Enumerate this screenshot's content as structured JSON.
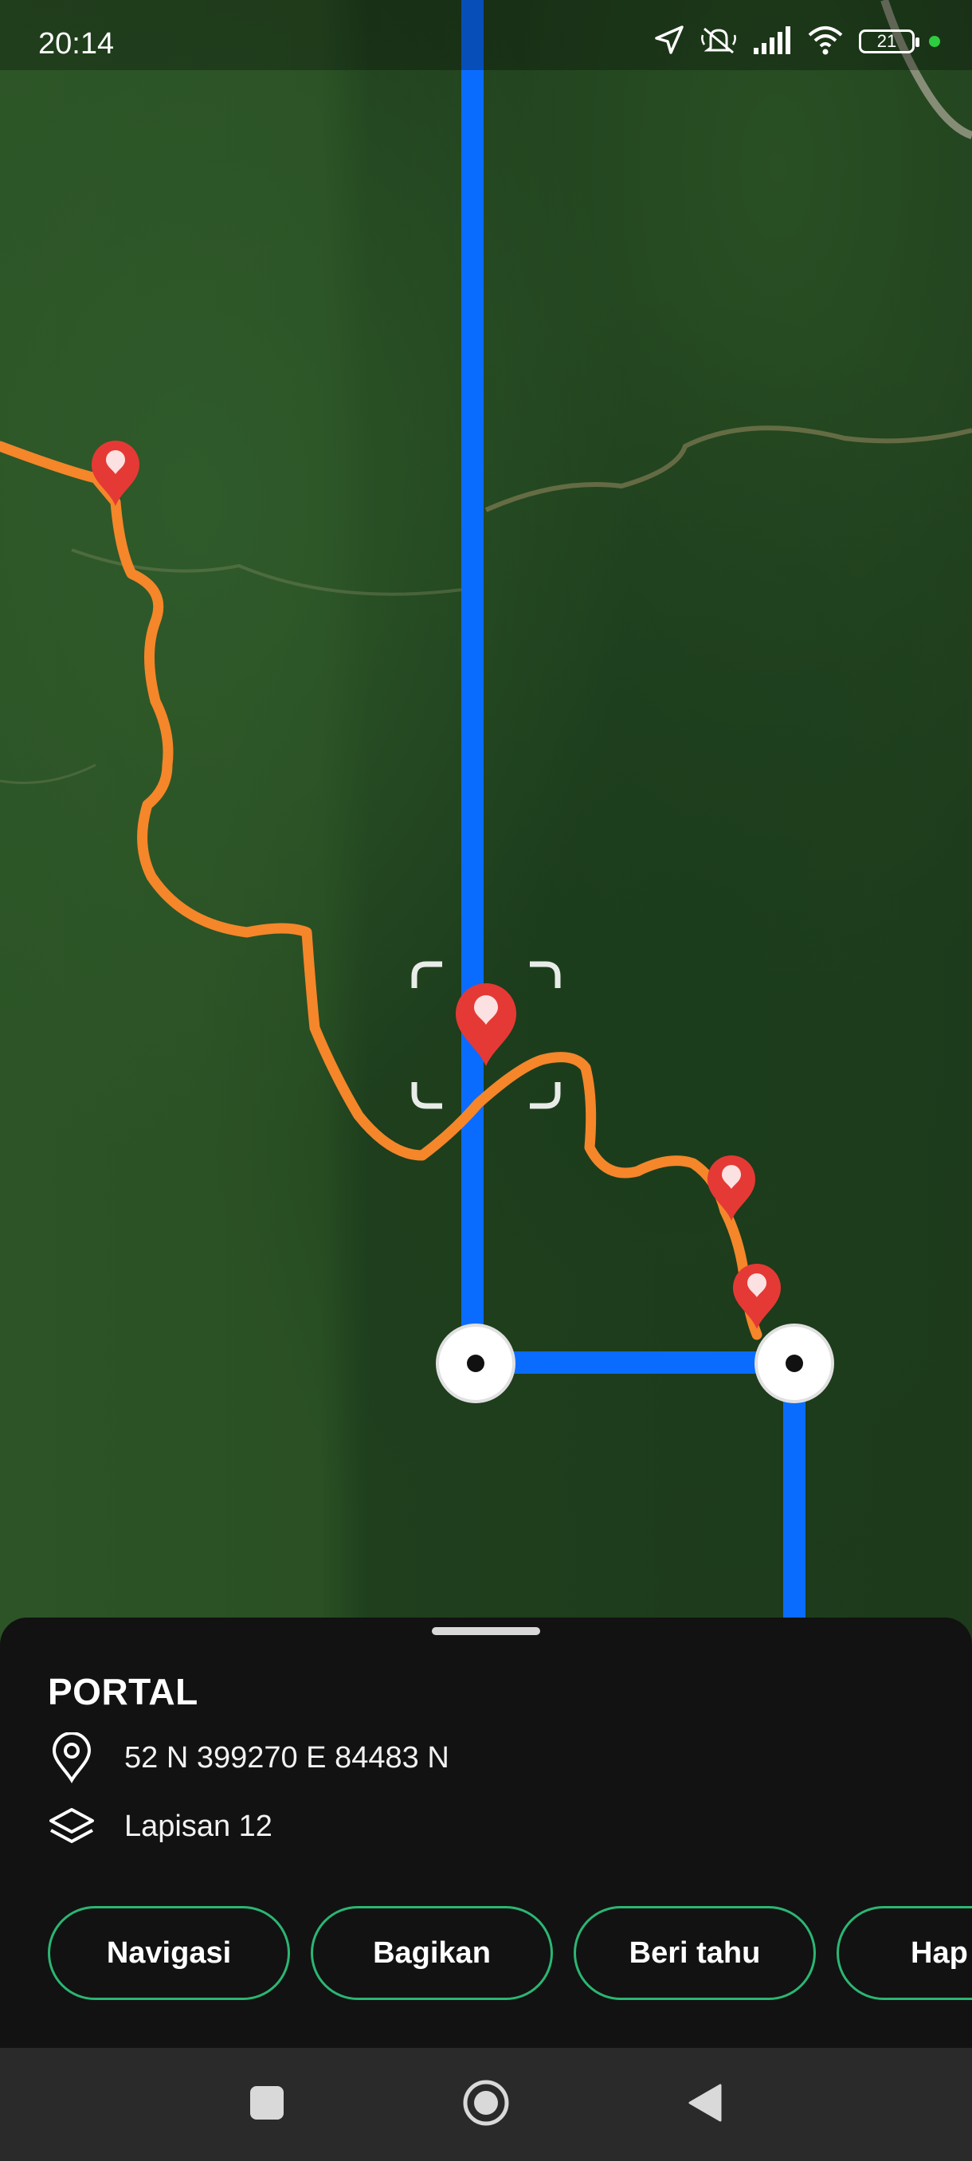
{
  "status_bar": {
    "time": "20:14",
    "battery_level": "21",
    "icons": [
      "location-arrow-icon",
      "mute-icon",
      "signal-icon",
      "wifi-icon",
      "battery-icon",
      "recording-dot"
    ]
  },
  "map": {
    "colors": {
      "route_blue": "#0a6cff",
      "track_orange": "#f5862a",
      "marker_red": "#e53935"
    },
    "markers_count": 4
  },
  "sheet": {
    "title": "PORTAL",
    "coordinates": "52 N 399270 E 84483 N",
    "layer": "Lapisan 12",
    "actions": [
      {
        "label": "Navigasi"
      },
      {
        "label": "Bagikan"
      },
      {
        "label": "Beri tahu"
      },
      {
        "label": "Hap"
      }
    ],
    "accent_color": "#2bb673"
  },
  "nav_bar": {
    "buttons": [
      "recents-square-icon",
      "home-circle-icon",
      "back-triangle-icon"
    ]
  }
}
